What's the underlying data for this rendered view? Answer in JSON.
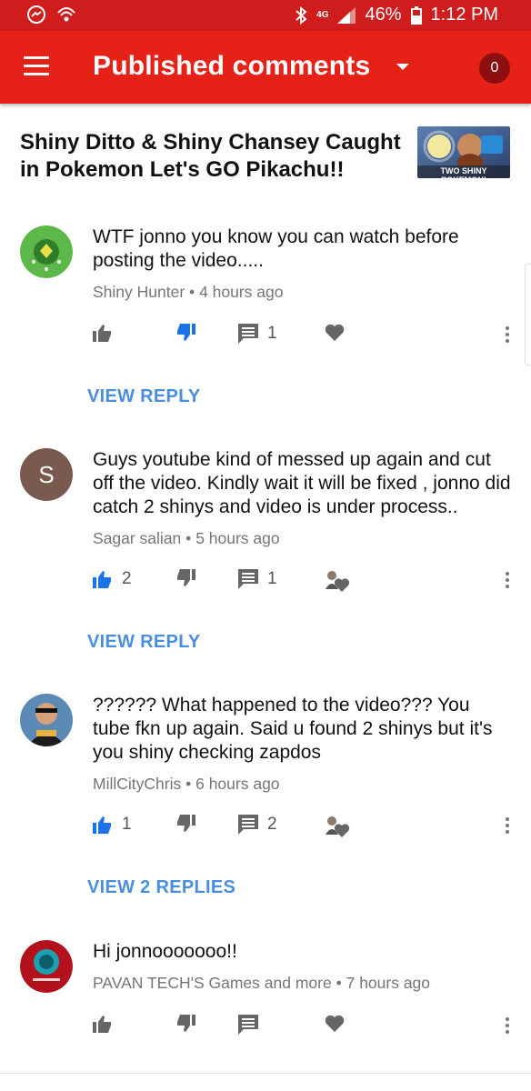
{
  "status": {
    "battery": "46%",
    "time": "1:12 PM",
    "signal_label": "4G"
  },
  "appbar": {
    "title": "Published comments",
    "count": "0"
  },
  "video": {
    "title": "Shiny Ditto & Shiny Chansey Caught in Pokemon Let's GO Pikachu!!",
    "thumb_text": "TWO SHINY POKEMON!"
  },
  "comments": [
    {
      "text": "WTF jonno you know you can watch before posting the video.....",
      "author": "Shiny Hunter",
      "time": "4 hours ago",
      "likes": "",
      "replies_count": "1",
      "reply_link": "VIEW REPLY"
    },
    {
      "text": "Guys youtube kind of messed up again and cut off the video. Kindly wait it will be fixed , jonno did catch 2 shinys and video is under process..",
      "author": "Sagar salian",
      "time": "5 hours ago",
      "avatar_letter": "S",
      "likes": "2",
      "replies_count": "1",
      "reply_link": "VIEW REPLY"
    },
    {
      "text": "?????? What happened to the video??? You tube fkn up again. Said u found 2 shinys but it's you shiny checking zapdos",
      "author": "MillCityChris",
      "time": "6 hours ago",
      "likes": "1",
      "replies_count": "2",
      "reply_link": "VIEW 2 REPLIES"
    },
    {
      "text": "Hi jonnooooooo!!",
      "author": "PAVAN TECH'S Games and more",
      "time": "7 hours ago",
      "likes": "",
      "replies_count": ""
    }
  ],
  "colors": {
    "brand_red": "#e62117",
    "status_red": "#cf1c1c",
    "link_blue": "#4a8fdf",
    "like_blue": "#1a73e8",
    "meta_gray": "#757575"
  },
  "icons": [
    "menu-icon",
    "dropdown-icon",
    "thumb-up-icon",
    "thumb-down-icon",
    "reply-icon",
    "heart-icon",
    "creator-heart-icon",
    "more-vert-icon"
  ],
  "meta_separator": "•"
}
